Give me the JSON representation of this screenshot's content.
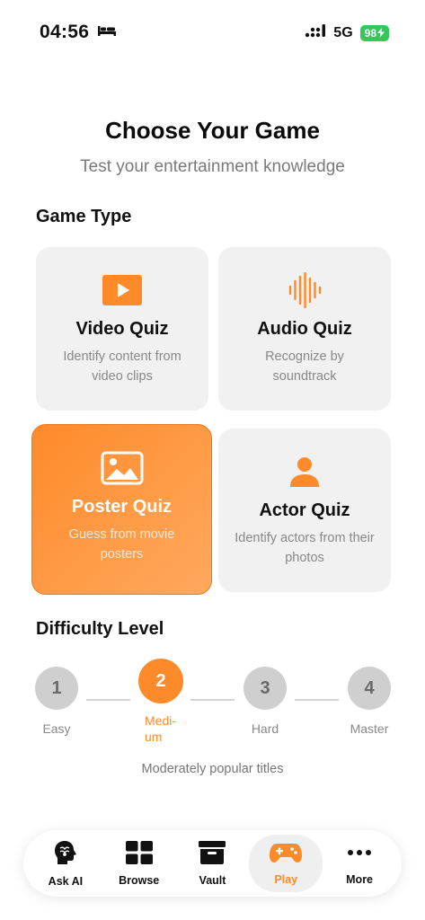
{
  "status": {
    "time": "04:56",
    "network": "5G",
    "battery": "98"
  },
  "header": {
    "title": "Choose Your Game",
    "subtitle": "Test your entertainment knowledge"
  },
  "game_type": {
    "heading": "Game Type",
    "cards": [
      {
        "title": "Video Quiz",
        "desc": "Identify content from video clips",
        "icon": "video-play-icon"
      },
      {
        "title": "Audio Quiz",
        "desc": "Recognize by soundtrack",
        "icon": "sound-wave-icon"
      },
      {
        "title": "Poster Quiz",
        "desc": "Guess from movie posters",
        "icon": "image-icon",
        "selected": true
      },
      {
        "title": "Actor Quiz",
        "desc": "Identify actors from their photos",
        "icon": "person-icon"
      }
    ]
  },
  "difficulty": {
    "heading": "Difficulty Level",
    "levels": [
      {
        "num": "1",
        "label": "Easy"
      },
      {
        "num": "2",
        "label": "Medi-um",
        "selected": true
      },
      {
        "num": "3",
        "label": "Hard"
      },
      {
        "num": "4",
        "label": "Master"
      }
    ],
    "description": "Moderately popular titles"
  },
  "tabs": [
    {
      "label": "Ask AI",
      "icon": "brain-head-icon"
    },
    {
      "label": "Browse",
      "icon": "grid-icon"
    },
    {
      "label": "Vault",
      "icon": "archive-box-icon"
    },
    {
      "label": "Play",
      "icon": "gamepad-icon",
      "active": true
    },
    {
      "label": "More",
      "icon": "more-dots-icon"
    }
  ],
  "colors": {
    "accent": "#ff8a2a",
    "card_bg": "#f1f1f1",
    "muted": "#888888"
  }
}
